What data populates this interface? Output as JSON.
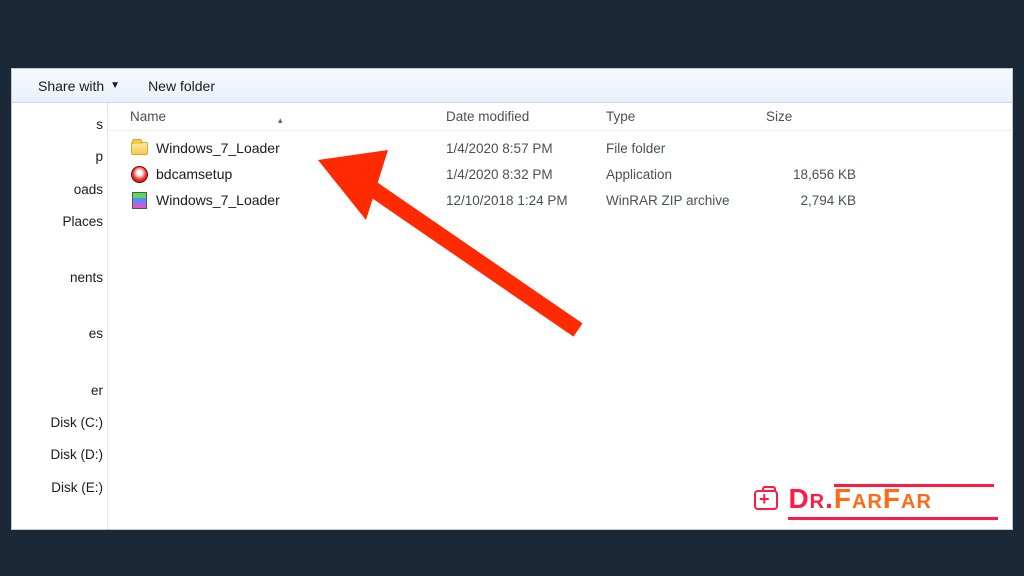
{
  "toolbar": {
    "share": "Share with",
    "new_folder": "New folder"
  },
  "columns": {
    "name": "Name",
    "date": "Date modified",
    "type": "Type",
    "size": "Size"
  },
  "nav": {
    "i0": "s",
    "i1": "p",
    "i2": "oads",
    "i3": "Places",
    "i4": "nents",
    "i5": "es",
    "i6": "er",
    "i7": "Disk (C:)",
    "i8": "Disk (D:)",
    "i9": "Disk (E:)"
  },
  "files": [
    {
      "name": "Windows_7_Loader",
      "date": "1/4/2020 8:57 PM",
      "type": "File folder",
      "size": "",
      "icon": "folder"
    },
    {
      "name": "bdcamsetup",
      "date": "1/4/2020 8:32 PM",
      "type": "Application",
      "size": "18,656 KB",
      "icon": "exe"
    },
    {
      "name": "Windows_7_Loader",
      "date": "12/10/2018 1:24 PM",
      "type": "WinRAR ZIP archive",
      "size": "2,794 KB",
      "icon": "zip"
    }
  ],
  "watermark": {
    "part1": "Dr.",
    "part2": "FarFar"
  },
  "arrow_color": "#ff2a00"
}
